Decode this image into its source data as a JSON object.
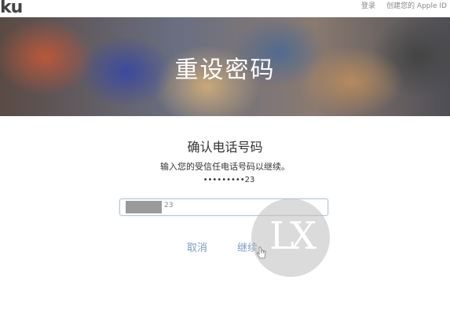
{
  "topbar": {
    "logo_text": "ku",
    "nav": [
      "登录",
      "创建您的 Apple ID"
    ]
  },
  "hero": {
    "title": "重设密码"
  },
  "form": {
    "heading": "确认电话号码",
    "instruction": "输入您的受信任电话号码以继续。",
    "masked_number": "•••••••••23",
    "input_suffix": "23",
    "cancel_label": "取消",
    "continue_label": "继续"
  },
  "watermark": {
    "text": "LX"
  },
  "colors": {
    "link": "#7d9cc3",
    "hero_text": "#ffffff"
  }
}
